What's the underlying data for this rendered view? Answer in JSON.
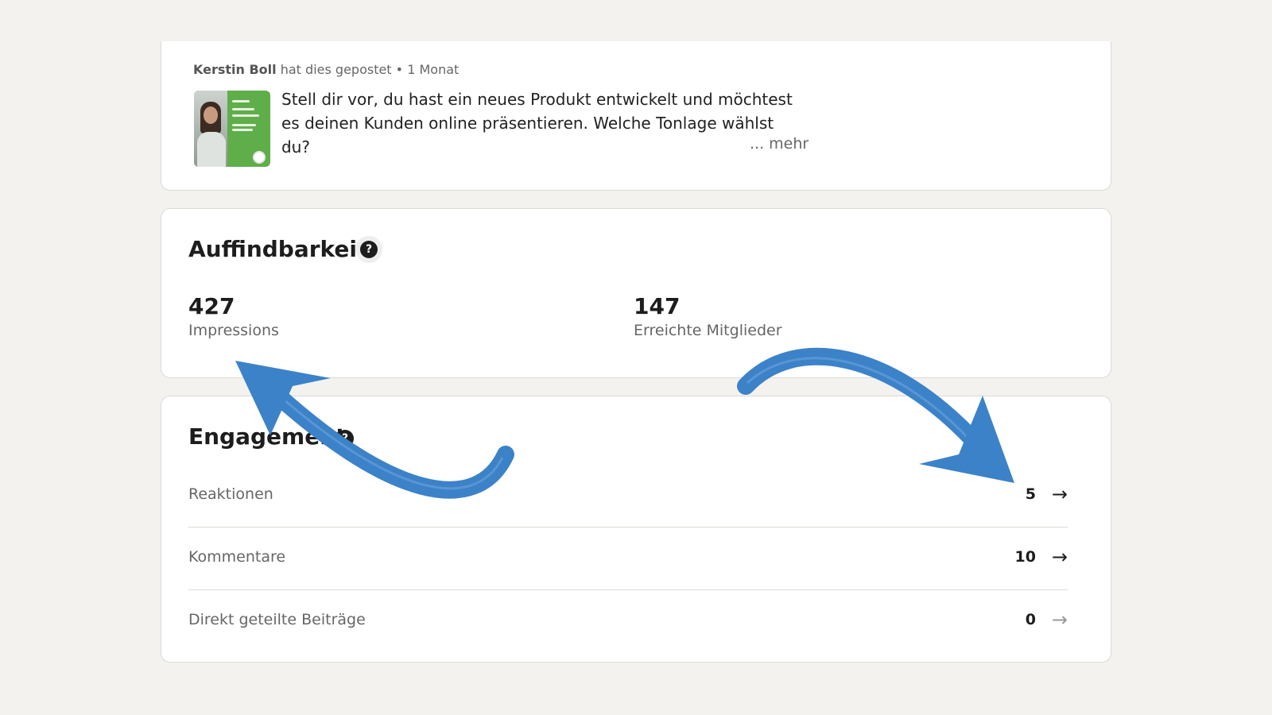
{
  "post": {
    "author": "Kerstin Boll",
    "action": "hat dies gepostet",
    "separator": "•",
    "time": "1 Monat",
    "text": "Stell dir vor, du hast ein neues Produkt entwickelt und möchtest es deinen Kunden online präsentieren. Welche Tonlage wählst du?",
    "ellipsis": "...",
    "more": "... mehr"
  },
  "discoverability": {
    "title": "Auffindbarkeit",
    "help_icon": "?",
    "metrics": [
      {
        "value": "427",
        "label": "Impressions"
      },
      {
        "value": "147",
        "label": "Erreichte Mitglieder"
      }
    ]
  },
  "engagement": {
    "title": "Engagement",
    "help_icon": "?",
    "rows": [
      {
        "label": "Reaktionen",
        "value": "5",
        "arrow": "→"
      },
      {
        "label": "Kommentare",
        "value": "10",
        "arrow": "→"
      },
      {
        "label": "Direkt geteilte Beiträge",
        "value": "0",
        "arrow": "→"
      }
    ]
  },
  "annotation_color": "#3c82c8"
}
